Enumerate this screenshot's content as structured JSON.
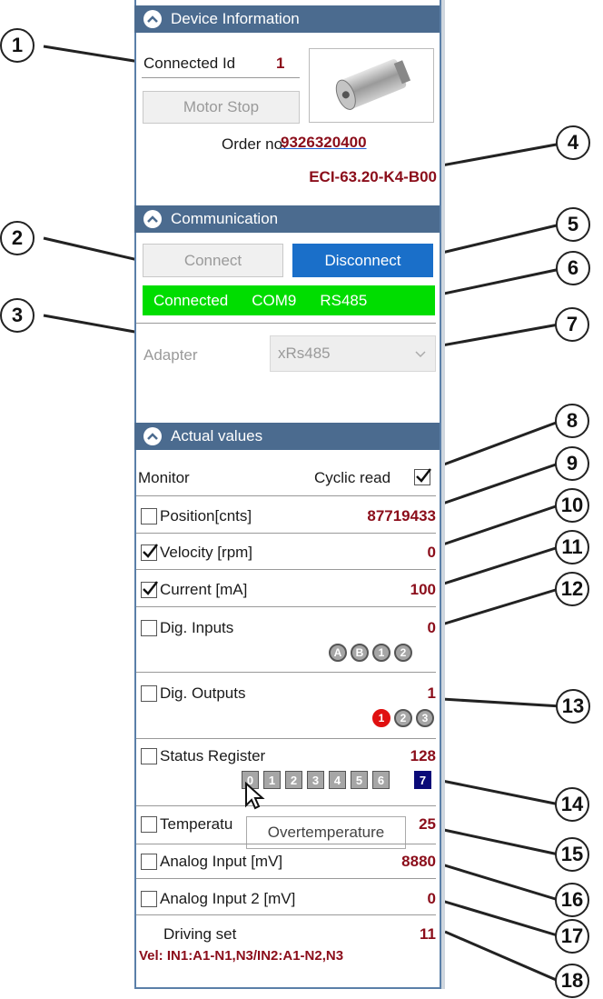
{
  "device_info": {
    "header": "Device Information",
    "connected_id_label": "Connected Id",
    "connected_id_value": "1",
    "motor_stop_label": "Motor Stop",
    "order_label": "Order no.",
    "order_number": "9326320400",
    "model": "ECI-63.20-K4-B00"
  },
  "communication": {
    "header": "Communication",
    "connect_label": "Connect",
    "disconnect_label": "Disconnect",
    "status_connected": "Connected",
    "status_port": "COM9",
    "status_protocol": "RS485",
    "adapter_label": "Adapter",
    "adapter_value": "xRs485"
  },
  "actual_values": {
    "header": "Actual values",
    "monitor_label": "Monitor",
    "cyclic_read_label": "Cyclic read",
    "cyclic_read_checked": true,
    "rows": [
      {
        "label": "Position[cnts]",
        "value": "87719433",
        "checked": false
      },
      {
        "label": "Velocity [rpm]",
        "value": "0",
        "checked": true
      },
      {
        "label": "Current [mA]",
        "value": "100",
        "checked": true
      },
      {
        "label": "Dig. Inputs",
        "value": "0",
        "checked": false
      },
      {
        "label": "Dig. Outputs",
        "value": "1",
        "checked": false
      },
      {
        "label": "Status Register",
        "value": "128",
        "checked": false
      },
      {
        "label": "Temperatu",
        "value": "25",
        "checked": false
      },
      {
        "label": "Analog Input [mV]",
        "value": "8880",
        "checked": false
      },
      {
        "label": "Analog Input 2 [mV]",
        "value": "0",
        "checked": false
      }
    ],
    "dig_inputs_badges": [
      "A",
      "B",
      "1",
      "2"
    ],
    "dig_outputs_badges": [
      "1",
      "2",
      "3"
    ],
    "status_bits": [
      "0",
      "1",
      "2",
      "3",
      "4",
      "5",
      "6",
      "7"
    ],
    "tooltip": "Overtemperature",
    "driving_set_label": "Driving set",
    "driving_set_value": "11",
    "driving_set_detail": "Vel: IN1:A1-N1,N3/IN2:A1-N2,N3"
  },
  "callouts": [
    "1",
    "2",
    "3",
    "4",
    "5",
    "6",
    "7",
    "8",
    "9",
    "10",
    "11",
    "12",
    "13",
    "14",
    "15",
    "16",
    "17",
    "18"
  ],
  "colors": {
    "header_bg": "#4b6b8f",
    "value_red": "#8b0d1a",
    "status_green": "#00dd00",
    "disconnect_blue": "#1a6fc9",
    "link_blue": "#1f5fd6"
  }
}
